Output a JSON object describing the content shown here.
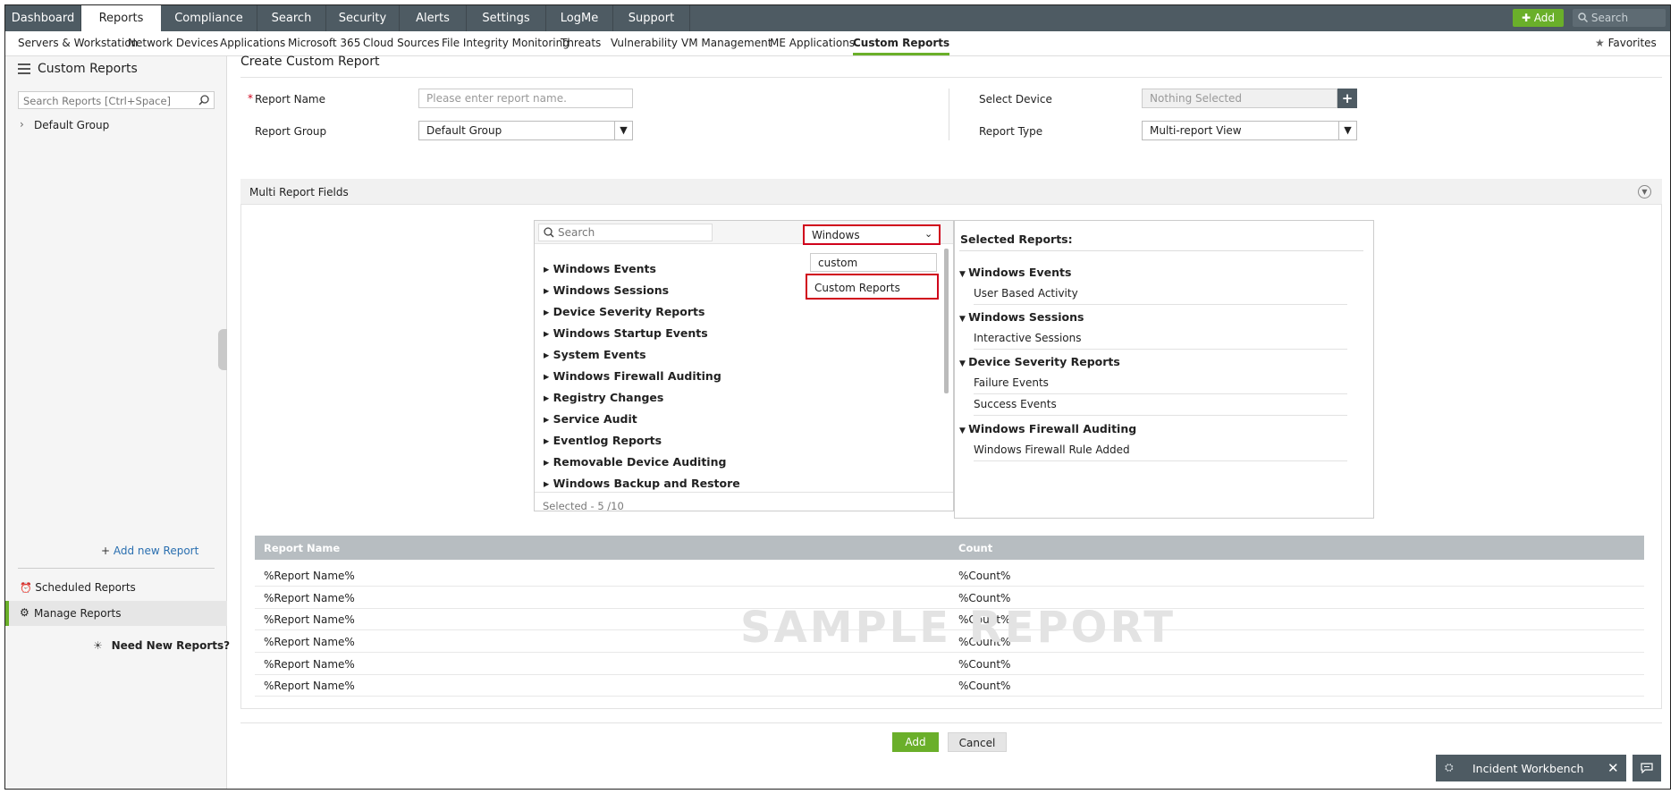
{
  "top_nav": {
    "tabs": [
      "Dashboard",
      "Reports",
      "Compliance",
      "Search",
      "Security",
      "Alerts",
      "Settings",
      "LogMe",
      "Support"
    ],
    "active_tab": "Reports",
    "add_label": "Add",
    "search_placeholder": "Search"
  },
  "sub_nav": {
    "items": [
      "Servers & Workstation",
      "Network Devices",
      "Applications",
      "Microsoft 365",
      "Cloud Sources",
      "File Integrity Monitoring",
      "Threats",
      "Vulnerability",
      "VM Management",
      "ME Applications",
      "Custom Reports"
    ],
    "active_item": "Custom Reports",
    "favorites_label": "Favorites"
  },
  "sidebar": {
    "title": "Custom Reports",
    "search_placeholder": "Search Reports [Ctrl+Space]",
    "tree_item": "Default Group",
    "add_new_report": "Add new Report",
    "scheduled_reports": "Scheduled Reports",
    "manage_reports": "Manage Reports",
    "need_new_reports": "Need New Reports?"
  },
  "main": {
    "page_title": "Create Custom Report",
    "form": {
      "report_name_label": "Report Name",
      "required_mark": "*",
      "report_name_placeholder": "Please enter report name.",
      "report_group_label": "Report Group",
      "report_group_value": "Default Group",
      "select_device_label": "Select Device",
      "select_device_placeholder": "Nothing Selected",
      "report_type_label": "Report Type",
      "report_type_value": "Multi-report View"
    },
    "multi_report": {
      "section_title": "Multi Report Fields",
      "search_placeholder": "Search",
      "category_select_value": "Windows",
      "dropdown_filter_value": "custom",
      "dropdown_option": "Custom Reports",
      "tree_items": [
        "Windows Events",
        "Windows Sessions",
        "Device Severity Reports",
        "Windows Startup Events",
        "System Events",
        "Windows Firewall Auditing",
        "Registry Changes",
        "Service Audit",
        "Eventlog Reports",
        "Removable Device Auditing",
        "Windows Backup and Restore"
      ],
      "selected_count": "Selected - 5 /10",
      "selected_title": "Selected Reports:",
      "selected_groups": [
        {
          "name": "Windows Events",
          "items": [
            "User Based Activity"
          ]
        },
        {
          "name": "Windows Sessions",
          "items": [
            "Interactive Sessions"
          ]
        },
        {
          "name": "Device Severity Reports",
          "items": [
            "Failure Events",
            "Success Events"
          ]
        },
        {
          "name": "Windows Firewall Auditing",
          "items": [
            "Windows Firewall Rule Added"
          ]
        }
      ]
    },
    "sample_table": {
      "columns": [
        "Report Name",
        "Count"
      ],
      "rows": [
        [
          "%Report Name%",
          "%Count%"
        ],
        [
          "%Report Name%",
          "%Count%"
        ],
        [
          "%Report Name%",
          "%Count%"
        ],
        [
          "%Report Name%",
          "%Count%"
        ],
        [
          "%Report Name%",
          "%Count%"
        ],
        [
          "%Report Name%",
          "%Count%"
        ]
      ],
      "watermark": "SAMPLE REPORT"
    },
    "add_button": "Add",
    "cancel_button": "Cancel"
  },
  "incident_workbench": {
    "label": "Incident Workbench"
  },
  "colors": {
    "accent_green": "#6aaf2a",
    "nav_bg": "#4e5b63",
    "highlight_red": "#d0021b"
  }
}
